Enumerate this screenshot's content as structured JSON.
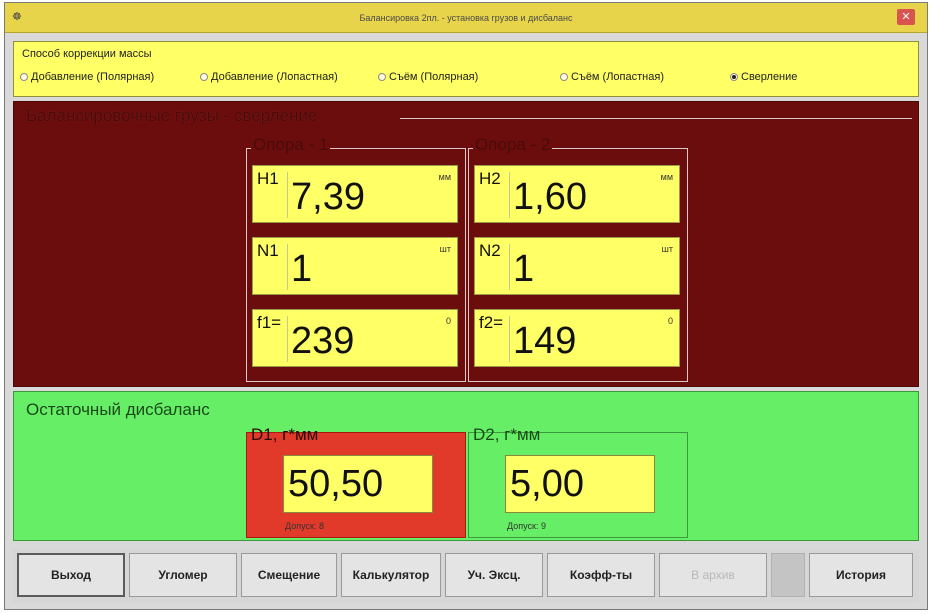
{
  "window": {
    "title": "Балансировка 2пл. - установка грузов и дисбаланс",
    "app_icon": "app-icon",
    "close_icon": "close-icon",
    "close_color": "#d9534f"
  },
  "correction": {
    "title": "Способ коррекции массы",
    "options": [
      {
        "label": "Добавление (Полярная)",
        "checked": false
      },
      {
        "label": "Добавление (Лопастная)",
        "checked": false
      },
      {
        "label": "Съём (Полярная)",
        "checked": false
      },
      {
        "label": "Съём (Лопастная)",
        "checked": false
      },
      {
        "label": "Сверление",
        "checked": true
      }
    ]
  },
  "weights": {
    "title": "Балансировочные грузы - сверление",
    "background": "#6b0d0d",
    "supports": [
      {
        "title": "Опора - 1",
        "fields": [
          {
            "label": "H1",
            "value": "7,39",
            "unit": "мм"
          },
          {
            "label": "N1",
            "value": "1",
            "unit": "шт"
          },
          {
            "label": "f1=",
            "value": "239",
            "unit": "0"
          }
        ]
      },
      {
        "title": "Опора - 2",
        "fields": [
          {
            "label": "H2",
            "value": "1,60",
            "unit": "мм"
          },
          {
            "label": "N2",
            "value": "1",
            "unit": "шт"
          },
          {
            "label": "f2=",
            "value": "149",
            "unit": "0"
          }
        ]
      }
    ]
  },
  "residual": {
    "title": "Остаточный дисбаланс",
    "background": "#66ee66",
    "d1": {
      "title": "D1, г*мм",
      "value": "50,50",
      "tolerance_label": "Допуск:",
      "tolerance": "8",
      "status_color": "#e23a2a"
    },
    "d2": {
      "title": "D2, г*мм",
      "value": "5,00",
      "tolerance_label": "Допуск:",
      "tolerance": "9"
    }
  },
  "buttons": [
    {
      "label": "Выход",
      "enabled": true
    },
    {
      "label": "Угломер",
      "enabled": true
    },
    {
      "label": "Смещение",
      "enabled": true
    },
    {
      "label": "Калькулятор",
      "enabled": true
    },
    {
      "label": "Уч. Эксц.",
      "enabled": true
    },
    {
      "label": "Коэфф-ты",
      "enabled": true
    },
    {
      "label": "В архив",
      "enabled": false
    },
    {
      "label": "История",
      "enabled": true
    }
  ]
}
